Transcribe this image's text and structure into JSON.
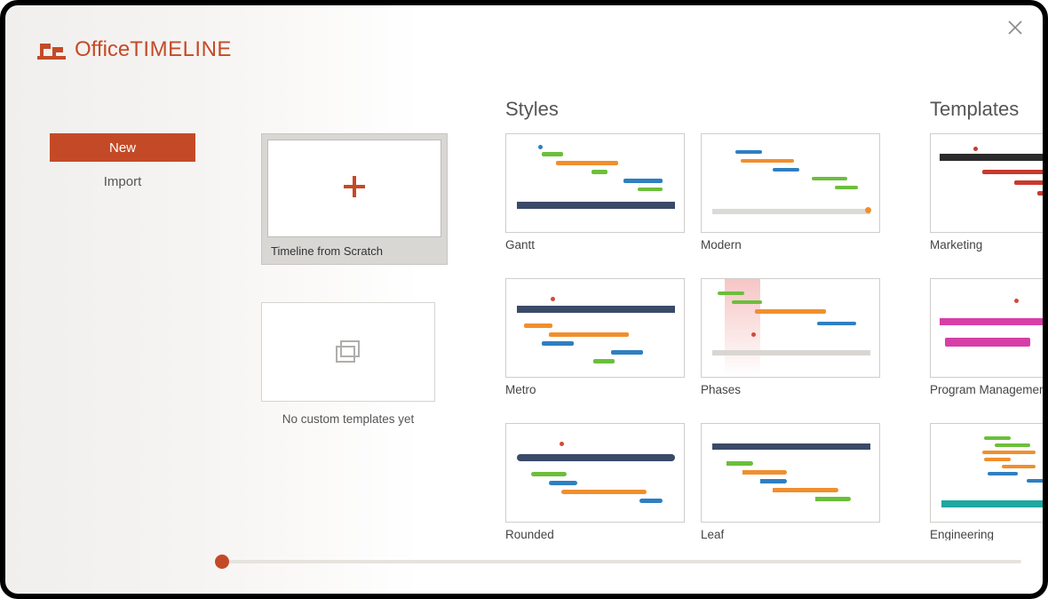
{
  "brand": {
    "name_light": "Office",
    "name_bold": "TIMELINE"
  },
  "nav": {
    "new_label": "New",
    "import_label": "Import"
  },
  "scratch": {
    "card_label": "Timeline from Scratch",
    "empty_label": "No custom templates yet"
  },
  "sections": {
    "styles_title": "Styles",
    "templates_title": "Templates"
  },
  "styles": [
    {
      "label": "Gantt"
    },
    {
      "label": "Modern"
    },
    {
      "label": "Metro"
    },
    {
      "label": "Phases"
    },
    {
      "label": "Rounded"
    },
    {
      "label": "Leaf"
    }
  ],
  "templates": [
    {
      "label": "Marketing"
    },
    {
      "label": "Program Management"
    },
    {
      "label": "Engineering"
    }
  ],
  "colors": {
    "accent": "#c44a27",
    "navy": "#3a4a68",
    "blue": "#2e7fc1",
    "green": "#6bbf3a",
    "orange": "#f08f2e",
    "magenta": "#d63fa8",
    "teal": "#1fa7a0",
    "red": "#d24a3a"
  }
}
